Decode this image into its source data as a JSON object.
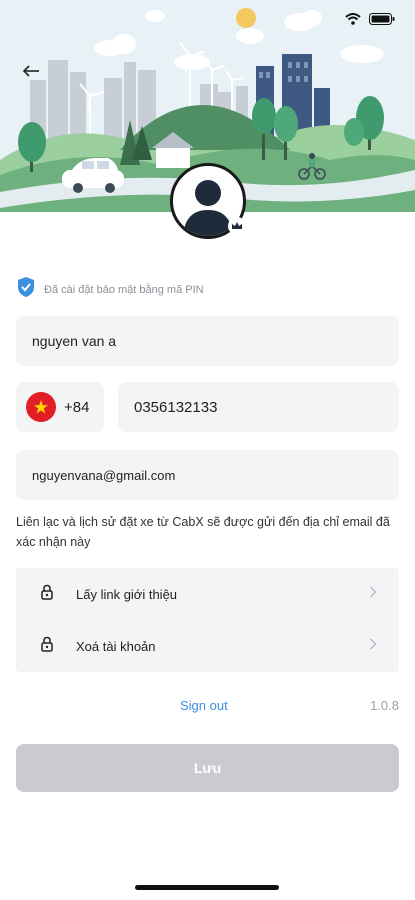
{
  "header": {
    "back_icon": "arrow-left-icon",
    "status_icons": [
      "wifi-icon",
      "battery-icon"
    ],
    "avatar_icon": "user-silhouette-icon",
    "edit_icon": "crown-edit-icon"
  },
  "pin_notice": {
    "icon": "shield-check-icon",
    "text": "Đã cài đặt bảo mật bằng mã PIN"
  },
  "form": {
    "name_value": "nguyen van a",
    "country_flag": "vietnam-flag",
    "country_code": "+84",
    "phone_value": "0356132133",
    "email_value": "nguyenvana@gmail.com"
  },
  "note_text": "Liên lạc và lịch sử đặt xe từ CabX sẽ được gửi đến địa chỉ email đã xác nhận này",
  "menu": {
    "items": [
      {
        "label": "Lấy link giới thiệu",
        "icon": "lock-icon"
      },
      {
        "label": "Xoá tài khoản",
        "icon": "lock-icon"
      }
    ]
  },
  "footer": {
    "sign_out": "Sign out",
    "version": "1.0.8"
  },
  "save_button": {
    "label": "Lưu"
  },
  "colors": {
    "accent": "#3d8fe0",
    "field_bg": "#f3f4f6",
    "disabled_button": "#c9cbd1",
    "flag_red": "#e21f26"
  }
}
